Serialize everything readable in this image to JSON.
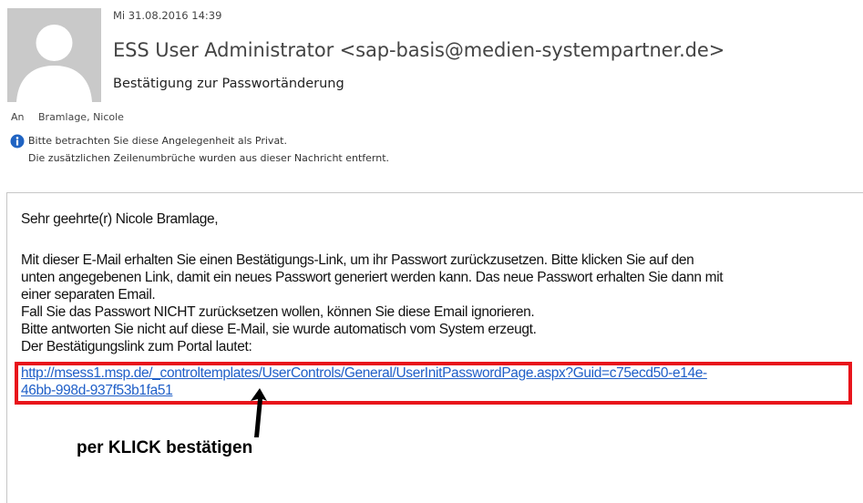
{
  "header": {
    "date": "Mi 31.08.2016 14:39",
    "sender": "ESS User Administrator <sap-basis@medien-systempartner.de>",
    "subject": "Bestätigung zur Passwortänderung",
    "to_label": "An",
    "to_value": "Bramlage, Nicole",
    "info_lines": [
      "Bitte betrachten Sie diese Angelegenheit als Privat.",
      "Die zusätzlichen Zeilenumbrüche wurden aus dieser Nachricht entfernt."
    ]
  },
  "body": {
    "greeting": "Sehr geehrte(r) Nicole Bramlage,",
    "lines": [
      "Mit dieser E-Mail erhalten Sie einen Bestätigungs-Link, um ihr Passwort zurückzusetzen. Bitte klicken Sie auf den",
      "unten angegebenen Link, damit ein neues Passwort generiert werden kann. Das neue Passwort erhalten Sie dann mit",
      "einer separaten Email.",
      "Fall Sie das Passwort NICHT zurücksetzen wollen, können Sie diese Email ignorieren.",
      "Bitte antworten Sie nicht auf diese E-Mail, sie wurde automatisch vom System erzeugt.",
      "Der Bestätigungslink zum Portal lautet:"
    ],
    "link_lines": [
      "http://msess1.msp.de/_controltemplates/UserControls/General/UserInitPasswordPage.aspx?Guid=c75ecd50-e14e-",
      "46bb-998d-937f53b1fa51"
    ]
  },
  "annotation": {
    "text": "per KLICK bestätigen",
    "highlight_color": "#e8141b"
  },
  "icons": {
    "avatar": "person-silhouette-icon",
    "info": "info-icon",
    "arrow": "arrow-up-icon"
  }
}
